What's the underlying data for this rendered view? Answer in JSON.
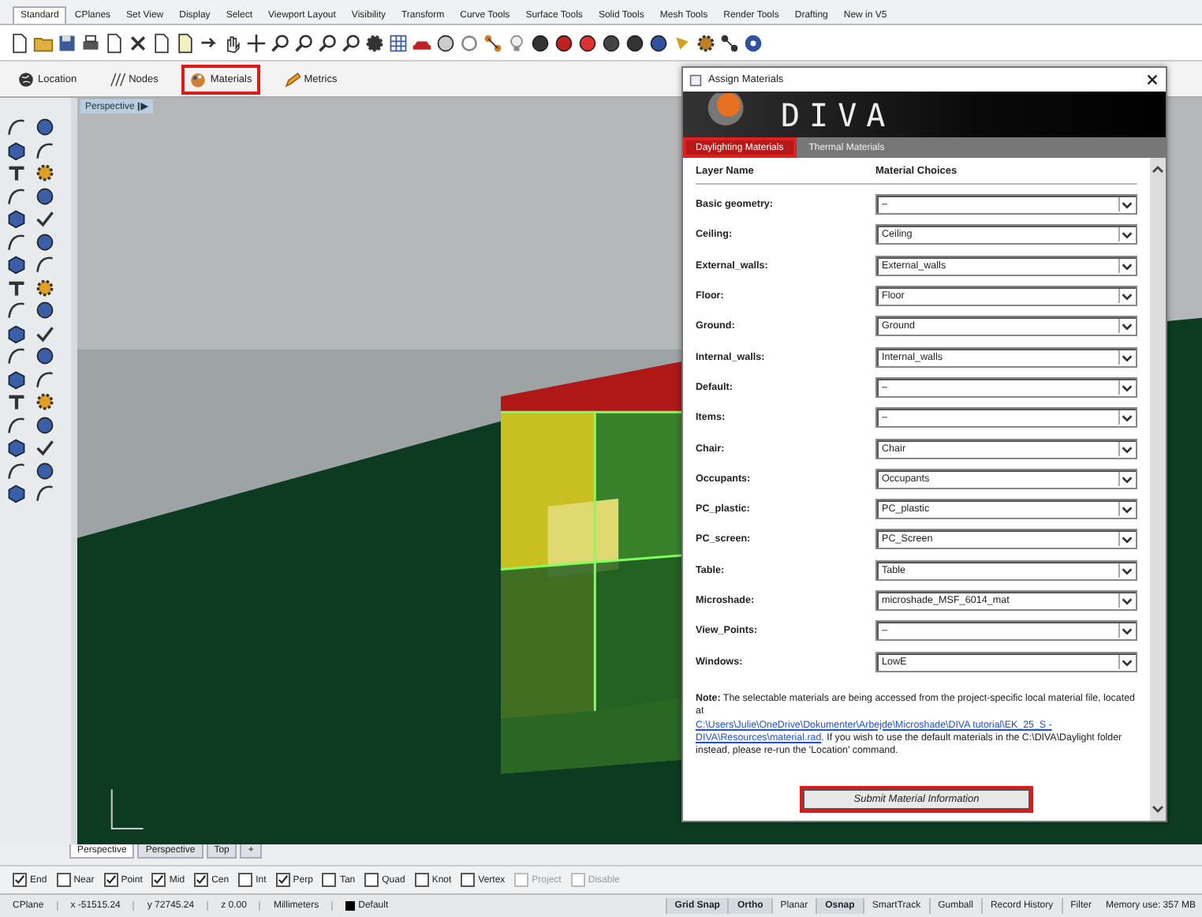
{
  "ribbon_tabs": [
    {
      "label": "Standard",
      "selected": true
    },
    {
      "label": "CPlanes",
      "selected": false
    },
    {
      "label": "Set View",
      "selected": false
    },
    {
      "label": "Display",
      "selected": false
    },
    {
      "label": "Select",
      "selected": false
    },
    {
      "label": "Viewport Layout",
      "selected": false
    },
    {
      "label": "Visibility",
      "selected": false
    },
    {
      "label": "Transform",
      "selected": false
    },
    {
      "label": "Curve Tools",
      "selected": false
    },
    {
      "label": "Surface Tools",
      "selected": false
    },
    {
      "label": "Solid Tools",
      "selected": false
    },
    {
      "label": "Mesh Tools",
      "selected": false
    },
    {
      "label": "Render Tools",
      "selected": false
    },
    {
      "label": "Drafting",
      "selected": false
    },
    {
      "label": "New in V5",
      "selected": false
    }
  ],
  "plugin_toolbar": [
    {
      "label": "Location",
      "kind": "globe",
      "highlighted": false
    },
    {
      "label": "Nodes",
      "kind": "nodes",
      "highlighted": false
    },
    {
      "label": "Materials",
      "kind": "materials",
      "highlighted": true
    },
    {
      "label": "Metrics",
      "kind": "metrics",
      "highlighted": false
    }
  ],
  "viewport": {
    "title": "Perspective"
  },
  "dialog": {
    "title": "Assign Materials",
    "logo": "DIVA",
    "tabs": [
      {
        "label": "Daylighting Materials",
        "selected": true,
        "highlighted": true
      },
      {
        "label": "Thermal Materials",
        "selected": false,
        "highlighted": false
      }
    ],
    "columns": [
      "Layer Name",
      "Material Choices"
    ],
    "rows": [
      {
        "layer": "Basic geometry:",
        "material": "–"
      },
      {
        "layer": "Ceiling:",
        "material": "Ceiling"
      },
      {
        "layer": "External_walls:",
        "material": "External_walls"
      },
      {
        "layer": "Floor:",
        "material": "Floor"
      },
      {
        "layer": "Ground:",
        "material": "Ground"
      },
      {
        "layer": "Internal_walls:",
        "material": "Internal_walls"
      },
      {
        "layer": "Default:",
        "material": "–"
      },
      {
        "layer": "Items:",
        "material": "–"
      },
      {
        "layer": "Chair:",
        "material": "Chair"
      },
      {
        "layer": "Occupants:",
        "material": "Occupants"
      },
      {
        "layer": "PC_plastic:",
        "material": "PC_plastic"
      },
      {
        "layer": "PC_screen:",
        "material": "PC_Screen"
      },
      {
        "layer": "Table:",
        "material": "Table"
      },
      {
        "layer": "Microshade:",
        "material": "microshade_MSF_6014_mat"
      },
      {
        "layer": "View_Points:",
        "material": "–"
      },
      {
        "layer": "Windows:",
        "material": "LowE"
      }
    ],
    "note": {
      "label": "Note:",
      "text": "The selectable materials are being accessed from the project-specific local material file, located at",
      "link": [
        "C:\\Users\\Julie\\OneDrive\\Dokumenter\\Arbejde\\Microshade\\DIVA tutorial\\EK_25_S -",
        "DIVA\\Resources\\material.rad"
      ],
      "after": ". If you wish to use the default materials in the C:\\DIVA\\Daylight folder instead, please re-run the 'Location' command."
    },
    "submit": {
      "label": "Submit Material Information",
      "highlighted": true
    }
  },
  "viewport_tabs": [
    {
      "label": "Perspective",
      "selected": true
    },
    {
      "label": "Perspective",
      "selected": false
    },
    {
      "label": "Top",
      "selected": false
    },
    {
      "label": "+",
      "selected": false
    }
  ],
  "osnaps": [
    {
      "label": "End",
      "checked": true,
      "disabled": false
    },
    {
      "label": "Near",
      "checked": false,
      "disabled": false
    },
    {
      "label": "Point",
      "checked": true,
      "disabled": false
    },
    {
      "label": "Mid",
      "checked": true,
      "disabled": false
    },
    {
      "label": "Cen",
      "checked": true,
      "disabled": false
    },
    {
      "label": "Int",
      "checked": false,
      "disabled": false
    },
    {
      "label": "Perp",
      "checked": true,
      "disabled": false
    },
    {
      "label": "Tan",
      "checked": false,
      "disabled": false
    },
    {
      "label": "Quad",
      "checked": false,
      "disabled": false
    },
    {
      "label": "Knot",
      "checked": false,
      "disabled": false
    },
    {
      "label": "Vertex",
      "checked": false,
      "disabled": false
    },
    {
      "label": "Project",
      "checked": false,
      "disabled": true
    },
    {
      "label": "Disable",
      "checked": false,
      "disabled": true
    }
  ],
  "status_bar": {
    "cells": [
      {
        "text": "CPlane",
        "kind": "text"
      },
      {
        "text": "x -51515.24",
        "kind": "text"
      },
      {
        "text": "y 72745.24",
        "kind": "text"
      },
      {
        "text": "z 0.00",
        "kind": "text"
      },
      {
        "text": "Millimeters",
        "kind": "text"
      },
      {
        "text": "Default",
        "kind": "layer"
      }
    ],
    "toggles": [
      {
        "label": "Grid Snap",
        "on": true
      },
      {
        "label": "Ortho",
        "on": true
      },
      {
        "label": "Planar",
        "on": false
      },
      {
        "label": "Osnap",
        "on": true
      },
      {
        "label": "SmartTrack",
        "on": false
      },
      {
        "label": "Gumball",
        "on": false
      },
      {
        "label": "Record History",
        "on": false
      },
      {
        "label": "Filter",
        "on": false
      }
    ],
    "memory": "Memory use: 357 MB"
  }
}
